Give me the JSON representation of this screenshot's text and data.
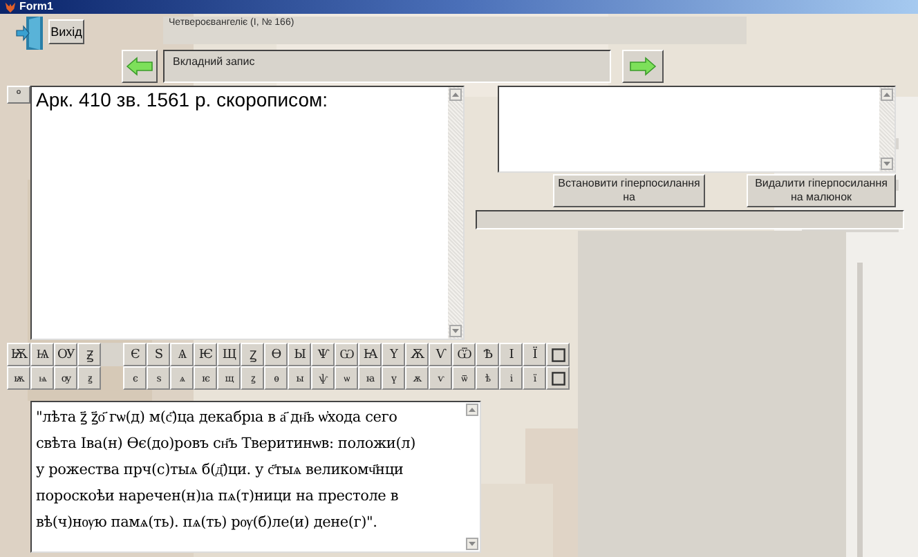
{
  "window": {
    "title": "Form1"
  },
  "exit_button": {
    "label": "Вихід"
  },
  "record_title": "Четвероєвангеліє (І, № 166)",
  "record_field": {
    "value": "Вкладний запис"
  },
  "description": {
    "value": "Арк. 410 зв. 1561 р. скорописом:"
  },
  "buttons": [
    {
      "label": "Встановити гіперпосилання на"
    },
    {
      "label": "Видалити гіперпосилання на малюнок"
    }
  ],
  "keyboard": {
    "rows": [
      [
        "Ѭ",
        "Ѩ",
        "ОУ",
        "Ꙃ",
        "Є",
        "Ѕ",
        "Ѧ",
        "Ѥ",
        "Щ",
        "Ꙁ",
        "Ѳ",
        "Ы",
        "Ѱ",
        "Ѡ",
        "Ꙗ",
        "Ү",
        "Ѫ",
        "Ѵ",
        "Ѿ",
        "Ѣ",
        "І",
        "Ї"
      ],
      [
        "ѭ",
        "ѩ",
        "оу",
        "ꙃ",
        "є",
        "ѕ",
        "ѧ",
        "ѥ",
        "щ",
        "ꙁ",
        "ѳ",
        "ы",
        "ѱ",
        "ѡ",
        "ꙗ",
        "ү",
        "ѫ",
        "ѵ",
        "ѿ",
        "ѣ",
        "і",
        "ї"
      ]
    ]
  },
  "transcription": {
    "value": "\"лѣта ꙁ҃ ꙁ҃о҃ гѡ(д) м(с҃)ца декабрıа в а҃ дн҃ь ѡ҆хода сего\nсвѣта Іва(н) Ѳє(до)ровъ сн҃ъ Тверитинѡв: положи(л)\nу рожества прч(с)тыѧ б(д҃)ци. у с҃тыѧ великомч҃нци\nпороскоѣи наречен(н)ıа пѧ(т)ници на престоле в\nвѣ(ч)нѹю памѧ(ть). пѧ(ть) рѹ(б)ле(и) дене(г)\"."
  }
}
